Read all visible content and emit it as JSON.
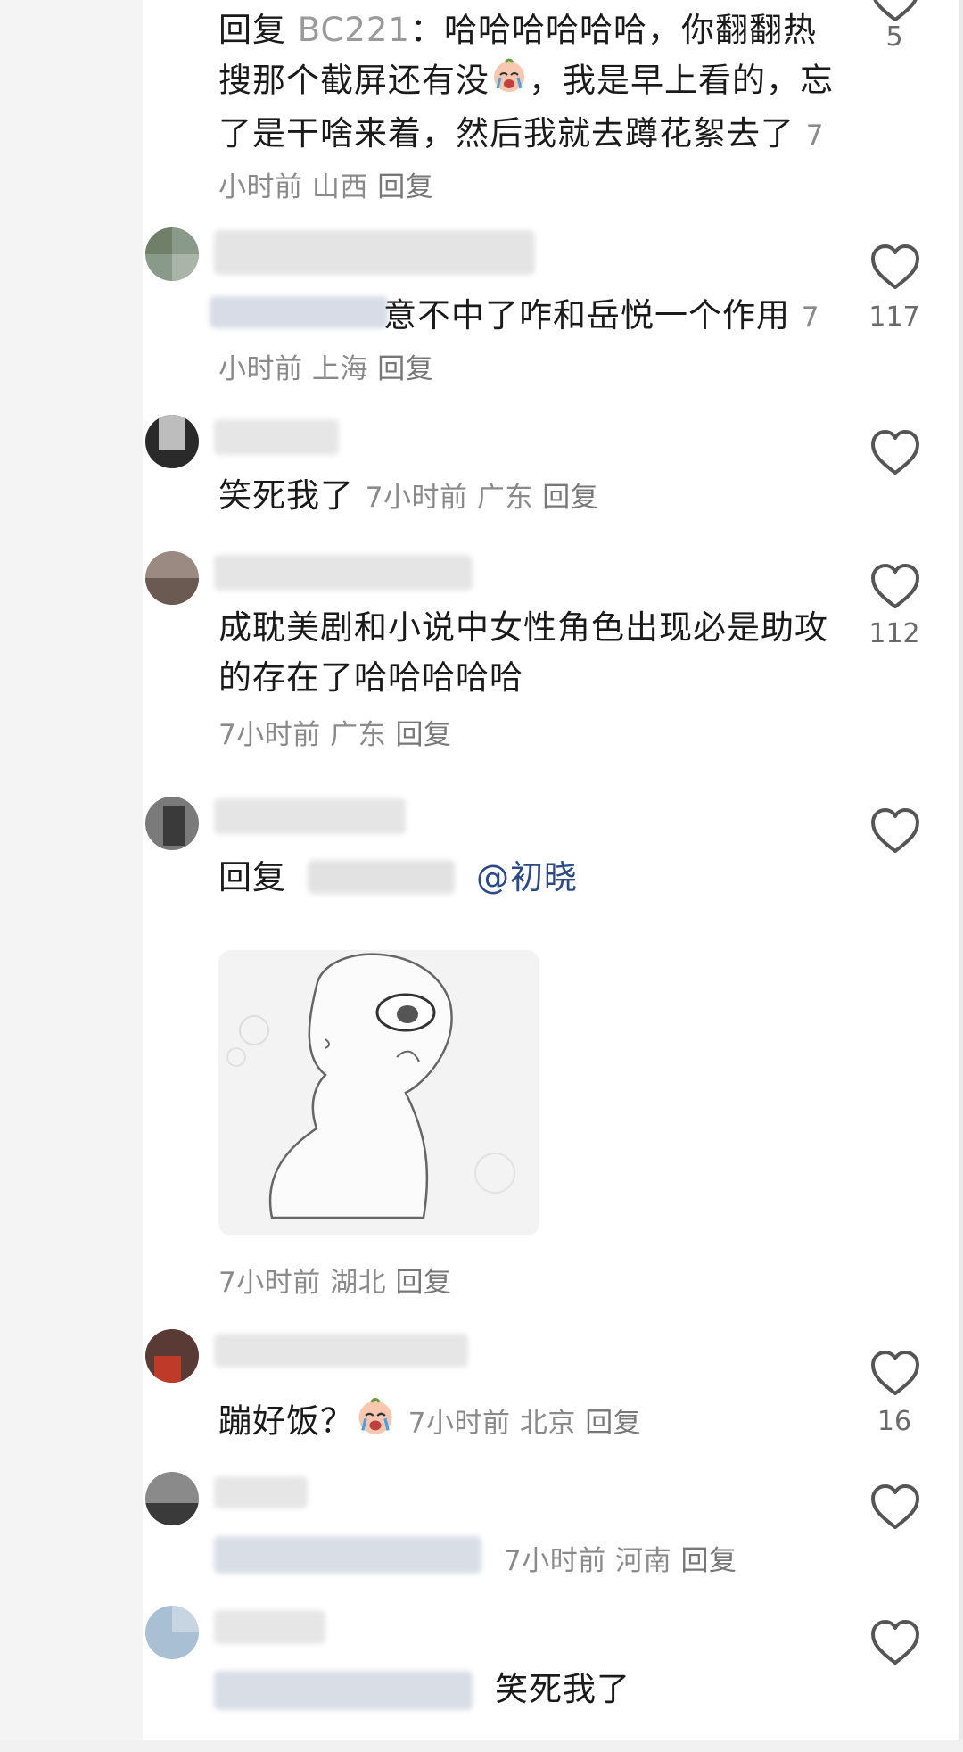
{
  "comments": [
    {
      "text_prefix": "回复 ",
      "mention": "BC221",
      "text": "：哈哈哈哈哈哈，你翻翻热搜那个截屏还有没",
      "text_after_emoji": "，我是早上看的，忘了是干啥来着，然后我就去蹲花絮去了",
      "time": "7小时前",
      "location": "山西",
      "reply": "回复",
      "likes": "5"
    },
    {
      "text": "意不中了咋和岳悦一个作用",
      "time": "7小时前",
      "location": "上海",
      "reply": "回复",
      "likes": "117"
    },
    {
      "text": "笑死我了",
      "time": "7小时前",
      "location": "广东",
      "reply": "回复",
      "likes": ""
    },
    {
      "text": "成耽美剧和小说中女性角色出现必是助攻的存在了哈哈哈哈哈",
      "time": "7小时前",
      "location": "广东",
      "reply": "回复",
      "likes": "112"
    },
    {
      "text_prefix": "回复",
      "at": "@初晓",
      "time": "7小时前",
      "location": "湖北",
      "reply": "回复",
      "likes": ""
    },
    {
      "text": "蹦好饭？",
      "time": "7小时前",
      "location": "北京",
      "reply": "回复",
      "likes": "16"
    },
    {
      "time": "7小时前",
      "location": "河南",
      "reply": "回复",
      "likes": ""
    },
    {
      "text_tail": "笑死我了",
      "likes": ""
    }
  ],
  "icons": {
    "like": "heart-outline-icon",
    "emoji": "crying-face-emoji"
  },
  "colors": {
    "text": "#1a1a1a",
    "meta": "#8a8a8a",
    "mention": "#9a9a9a",
    "at": "#2b4a86",
    "heart": "#555555"
  }
}
